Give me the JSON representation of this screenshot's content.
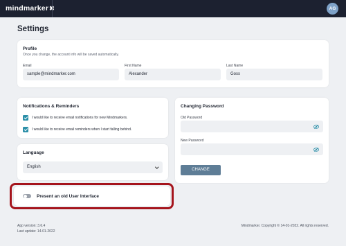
{
  "app": {
    "brand": "mindmarker",
    "avatar_initials": "AG"
  },
  "page": {
    "title": "Settings"
  },
  "profile": {
    "title": "Profile",
    "subtitle": "Once you change, the account info will be saved automatically.",
    "email_label": "Email",
    "email_value": "sample@mindmarker.com",
    "first_name_label": "First Name",
    "first_name_value": "Alexander",
    "last_name_label": "Last Name",
    "last_name_value": "Goss"
  },
  "notifications": {
    "title": "Notifications & Reminders",
    "items": [
      {
        "label": "I would like to receive email notifications for new Mindmarkers.",
        "checked": true
      },
      {
        "label": "I would like to receive email reminders when I start falling behind.",
        "checked": true
      }
    ]
  },
  "language": {
    "title": "Language",
    "selected": "English"
  },
  "old_ui": {
    "label": "Present an old User Interface",
    "enabled": false
  },
  "password": {
    "title": "Changing Password",
    "old_label": "Old Password",
    "new_label": "New Password",
    "button": "CHANGE"
  },
  "footer": {
    "version": "App version: 3.6.4",
    "updated": "Last update: 14-01-2022",
    "copyright": "Mindmarker. Copyright © 14-01-2022. All rights reserved."
  },
  "colors": {
    "accent": "#2b8fa8",
    "button": "#5e7d96",
    "highlight": "#a5141c",
    "topbar": "#1c2130"
  }
}
